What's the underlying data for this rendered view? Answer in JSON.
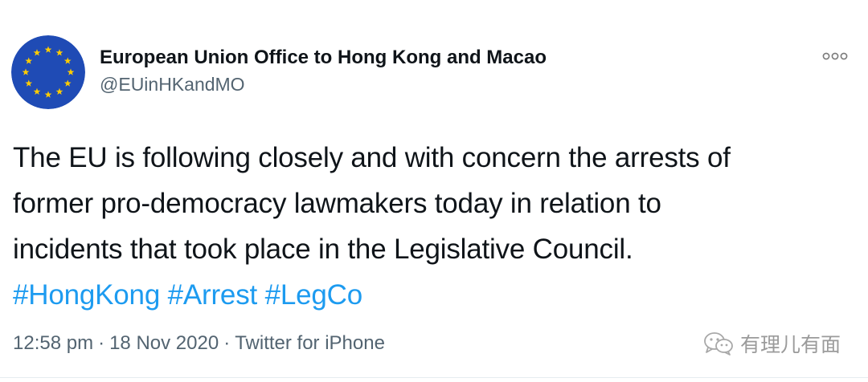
{
  "tweet": {
    "author": {
      "display_name": "European Union Office to Hong Kong and Macao",
      "handle": "@EUinHKandMO",
      "avatar_icon": "eu-flag-icon"
    },
    "more_icon": "more-options-icon",
    "text_lines": [
      "The EU is following closely and with concern the arrests of",
      "former pro-democracy lawmakers today in relation to",
      "incidents that took place in the Legislative Council."
    ],
    "hashtags": [
      "#HongKong",
      "#Arrest",
      "#LegCo"
    ],
    "meta": {
      "time": "12:58 pm",
      "separator": "·",
      "date": "18 Nov 2020",
      "source": "Twitter for iPhone"
    }
  },
  "watermark": {
    "icon": "wechat-icon",
    "text": "有理儿有面"
  },
  "colors": {
    "link": "#1d9bf0",
    "secondary_text": "#536471",
    "primary_text": "#0f1419",
    "eu_blue": "#003399",
    "eu_gold": "#ffcc00"
  }
}
